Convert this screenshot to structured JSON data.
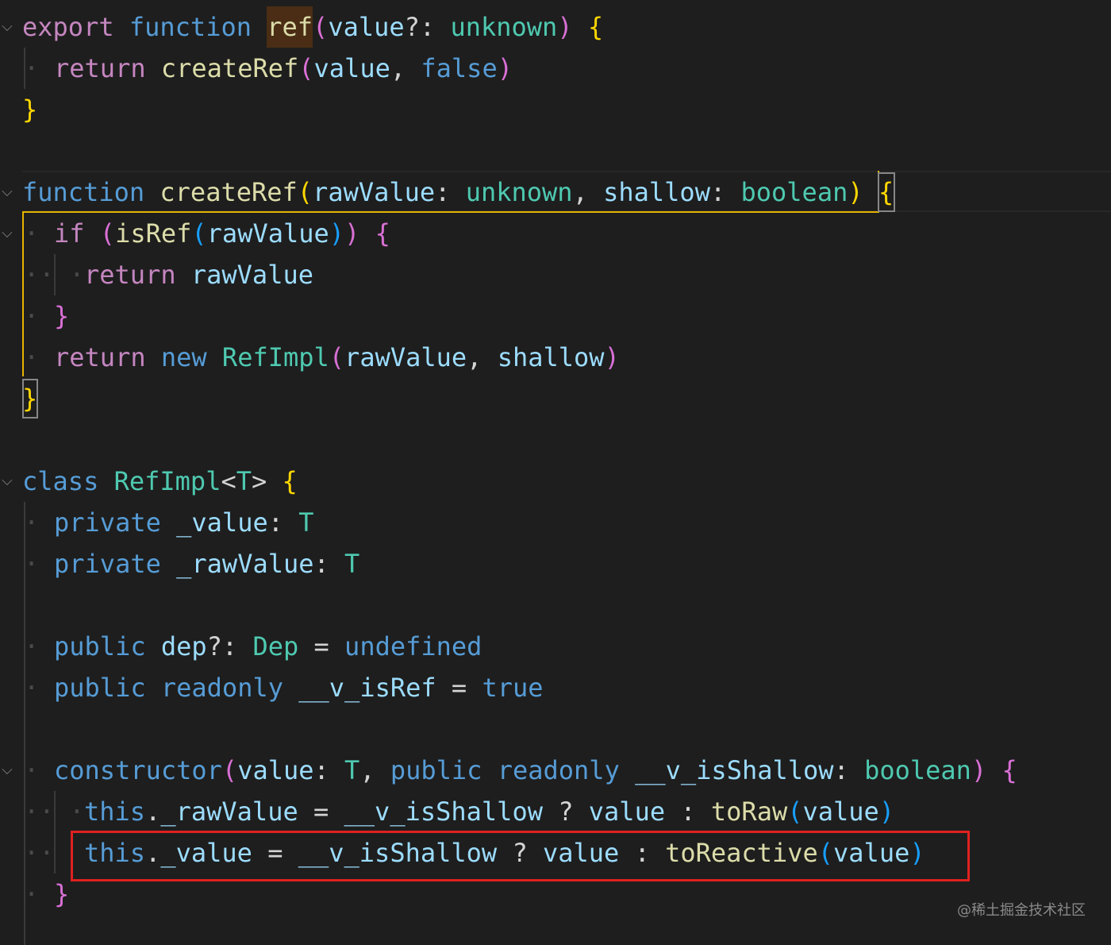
{
  "colors": {
    "background": "#1e1e1e",
    "keyword_pink": "#c586c0",
    "keyword_blue": "#569cd6",
    "function_yellow": "#dcdcaa",
    "variable_lightblue": "#9cdcfe",
    "type_teal": "#4ec9b0",
    "bracket_gold": "#ffd700",
    "bracket_pink": "#da70d6",
    "bracket_blue": "#179fff",
    "punctuation": "#d4d4d4",
    "annotation_red": "#e02020"
  },
  "code_lines": [
    [
      {
        "text": "export",
        "color": "#c586c0"
      },
      {
        "text": " "
      },
      {
        "text": "function",
        "color": "#569cd6"
      },
      {
        "text": " "
      },
      {
        "text": "ref",
        "color": "#dcdcaa"
      },
      {
        "text": "(",
        "color": "#da70d6"
      },
      {
        "text": "value",
        "color": "#9cdcfe"
      },
      {
        "text": "?: ",
        "color": "#d4d4d4"
      },
      {
        "text": "unknown",
        "color": "#4ec9b0"
      },
      {
        "text": ")",
        "color": "#da70d6"
      },
      {
        "text": " "
      },
      {
        "text": "{",
        "color": "#ffd700"
      }
    ],
    [
      {
        "text": "return",
        "color": "#c586c0"
      },
      {
        "text": " "
      },
      {
        "text": "createRef",
        "color": "#dcdcaa"
      },
      {
        "text": "(",
        "color": "#da70d6"
      },
      {
        "text": "value",
        "color": "#9cdcfe"
      },
      {
        "text": ", ",
        "color": "#d4d4d4"
      },
      {
        "text": "false",
        "color": "#569cd6"
      },
      {
        "text": ")",
        "color": "#da70d6"
      }
    ],
    [
      {
        "text": "}",
        "color": "#ffd700"
      }
    ],
    [],
    [
      {
        "text": "function",
        "color": "#569cd6"
      },
      {
        "text": " "
      },
      {
        "text": "createRef",
        "color": "#dcdcaa"
      },
      {
        "text": "(",
        "color": "#ffd700"
      },
      {
        "text": "rawValue",
        "color": "#9cdcfe"
      },
      {
        "text": ": ",
        "color": "#d4d4d4"
      },
      {
        "text": "unknown",
        "color": "#4ec9b0"
      },
      {
        "text": ", ",
        "color": "#d4d4d4"
      },
      {
        "text": "shallow",
        "color": "#9cdcfe"
      },
      {
        "text": ": ",
        "color": "#d4d4d4"
      },
      {
        "text": "boolean",
        "color": "#4ec9b0"
      },
      {
        "text": ")",
        "color": "#ffd700"
      },
      {
        "text": " "
      },
      {
        "text": "{",
        "color": "#ffd700"
      }
    ],
    [
      {
        "text": "if",
        "color": "#c586c0"
      },
      {
        "text": " "
      },
      {
        "text": "(",
        "color": "#da70d6"
      },
      {
        "text": "isRef",
        "color": "#dcdcaa"
      },
      {
        "text": "(",
        "color": "#179fff"
      },
      {
        "text": "rawValue",
        "color": "#9cdcfe"
      },
      {
        "text": ")",
        "color": "#179fff"
      },
      {
        "text": ")",
        "color": "#da70d6"
      },
      {
        "text": " "
      },
      {
        "text": "{",
        "color": "#da70d6"
      }
    ],
    [
      {
        "text": "return",
        "color": "#c586c0"
      },
      {
        "text": " "
      },
      {
        "text": "rawValue",
        "color": "#9cdcfe"
      }
    ],
    [
      {
        "text": "}",
        "color": "#da70d6"
      }
    ],
    [
      {
        "text": "return",
        "color": "#c586c0"
      },
      {
        "text": " "
      },
      {
        "text": "new",
        "color": "#569cd6"
      },
      {
        "text": " "
      },
      {
        "text": "RefImpl",
        "color": "#4ec9b0"
      },
      {
        "text": "(",
        "color": "#da70d6"
      },
      {
        "text": "rawValue",
        "color": "#9cdcfe"
      },
      {
        "text": ", ",
        "color": "#d4d4d4"
      },
      {
        "text": "shallow",
        "color": "#9cdcfe"
      },
      {
        "text": ")",
        "color": "#da70d6"
      }
    ],
    [
      {
        "text": "}",
        "color": "#ffd700"
      }
    ],
    [],
    [
      {
        "text": "class",
        "color": "#569cd6"
      },
      {
        "text": " "
      },
      {
        "text": "RefImpl",
        "color": "#4ec9b0"
      },
      {
        "text": "<",
        "color": "#d4d4d4"
      },
      {
        "text": "T",
        "color": "#4ec9b0"
      },
      {
        "text": ">",
        "color": "#d4d4d4"
      },
      {
        "text": " "
      },
      {
        "text": "{",
        "color": "#ffd700"
      }
    ],
    [
      {
        "text": "private",
        "color": "#569cd6"
      },
      {
        "text": " "
      },
      {
        "text": "_value",
        "color": "#9cdcfe"
      },
      {
        "text": ": ",
        "color": "#d4d4d4"
      },
      {
        "text": "T",
        "color": "#4ec9b0"
      }
    ],
    [
      {
        "text": "private",
        "color": "#569cd6"
      },
      {
        "text": " "
      },
      {
        "text": "_rawValue",
        "color": "#9cdcfe"
      },
      {
        "text": ": ",
        "color": "#d4d4d4"
      },
      {
        "text": "T",
        "color": "#4ec9b0"
      }
    ],
    [],
    [
      {
        "text": "public",
        "color": "#569cd6"
      },
      {
        "text": " "
      },
      {
        "text": "dep",
        "color": "#9cdcfe"
      },
      {
        "text": "?: ",
        "color": "#d4d4d4"
      },
      {
        "text": "Dep",
        "color": "#4ec9b0"
      },
      {
        "text": " = ",
        "color": "#d4d4d4"
      },
      {
        "text": "undefined",
        "color": "#569cd6"
      }
    ],
    [
      {
        "text": "public",
        "color": "#569cd6"
      },
      {
        "text": " "
      },
      {
        "text": "readonly",
        "color": "#569cd6"
      },
      {
        "text": " "
      },
      {
        "text": "__v_isRef",
        "color": "#9cdcfe"
      },
      {
        "text": " = ",
        "color": "#d4d4d4"
      },
      {
        "text": "true",
        "color": "#569cd6"
      }
    ],
    [],
    [
      {
        "text": "constructor",
        "color": "#569cd6"
      },
      {
        "text": "(",
        "color": "#da70d6"
      },
      {
        "text": "value",
        "color": "#9cdcfe"
      },
      {
        "text": ": ",
        "color": "#d4d4d4"
      },
      {
        "text": "T",
        "color": "#4ec9b0"
      },
      {
        "text": ", ",
        "color": "#d4d4d4"
      },
      {
        "text": "public",
        "color": "#569cd6"
      },
      {
        "text": " "
      },
      {
        "text": "readonly",
        "color": "#569cd6"
      },
      {
        "text": " "
      },
      {
        "text": "__v_isShallow",
        "color": "#9cdcfe"
      },
      {
        "text": ": ",
        "color": "#d4d4d4"
      },
      {
        "text": "boolean",
        "color": "#4ec9b0"
      },
      {
        "text": ")",
        "color": "#da70d6"
      },
      {
        "text": " "
      },
      {
        "text": "{",
        "color": "#da70d6"
      }
    ],
    [
      {
        "text": "this",
        "color": "#569cd6"
      },
      {
        "text": ".",
        "color": "#d4d4d4"
      },
      {
        "text": "_rawValue",
        "color": "#9cdcfe"
      },
      {
        "text": " = ",
        "color": "#d4d4d4"
      },
      {
        "text": "__v_isShallow",
        "color": "#9cdcfe"
      },
      {
        "text": " ? ",
        "color": "#d4d4d4"
      },
      {
        "text": "value",
        "color": "#9cdcfe"
      },
      {
        "text": " : ",
        "color": "#d4d4d4"
      },
      {
        "text": "toRaw",
        "color": "#dcdcaa"
      },
      {
        "text": "(",
        "color": "#179fff"
      },
      {
        "text": "value",
        "color": "#9cdcfe"
      },
      {
        "text": ")",
        "color": "#179fff"
      }
    ],
    [
      {
        "text": "this",
        "color": "#569cd6"
      },
      {
        "text": ".",
        "color": "#d4d4d4"
      },
      {
        "text": "_value",
        "color": "#9cdcfe"
      },
      {
        "text": " = ",
        "color": "#d4d4d4"
      },
      {
        "text": "__v_isShallow",
        "color": "#9cdcfe"
      },
      {
        "text": " ? ",
        "color": "#d4d4d4"
      },
      {
        "text": "value",
        "color": "#9cdcfe"
      },
      {
        "text": " : ",
        "color": "#d4d4d4"
      },
      {
        "text": "toReactive",
        "color": "#dcdcaa"
      },
      {
        "text": "(",
        "color": "#179fff"
      },
      {
        "text": "value",
        "color": "#9cdcfe"
      },
      {
        "text": ")",
        "color": "#179fff"
      }
    ],
    [
      {
        "text": "}",
        "color": "#da70d6"
      }
    ]
  ],
  "watermark": "@稀土掘金技术社区"
}
